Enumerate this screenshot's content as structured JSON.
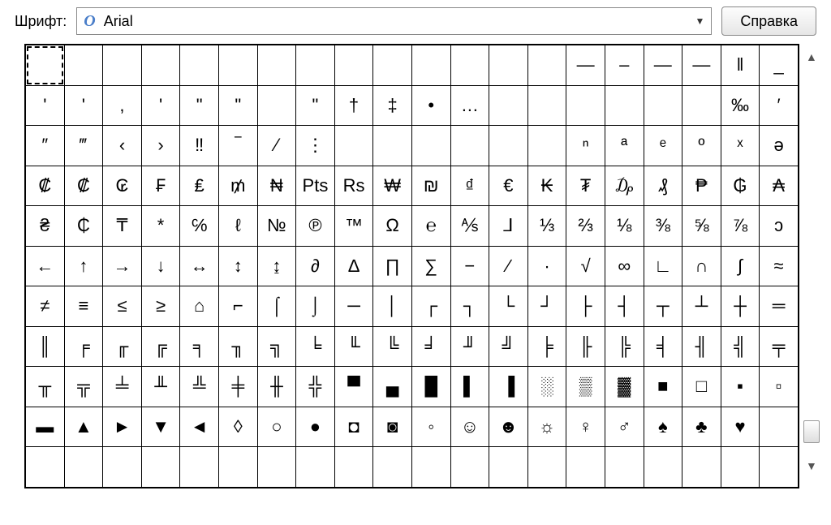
{
  "toolbar": {
    "font_label": "Шрифт:",
    "font_icon": "O",
    "font_name": "Arial",
    "help_label": "Справка"
  },
  "chart_data": {
    "type": "table",
    "title": "Character map grid",
    "columns": 20,
    "rows": 11,
    "selected_index": 0,
    "cells": [
      "",
      "",
      "",
      "",
      "",
      "",
      "",
      "",
      "",
      "",
      "",
      "",
      "",
      "",
      "—",
      "–",
      "—",
      "—",
      "‖",
      "_",
      "'",
      "'",
      ",",
      "'",
      "\"",
      "\"",
      "",
      "\"",
      "†",
      "‡",
      "•",
      "…",
      "",
      "",
      "",
      "",
      "",
      "",
      "‰",
      "′",
      "″",
      "‴",
      "‹",
      "›",
      "‼",
      "‾",
      "⁄",
      "⋮",
      "",
      "",
      "",
      "",
      "",
      "",
      "ⁿ",
      "ª",
      "ᵉ",
      "º",
      "ˣ",
      "ə",
      "₡",
      "₡",
      "₢",
      "₣",
      "₤",
      "₥",
      "₦",
      "Pts",
      "Rs",
      "₩",
      "₪",
      "₫",
      "€",
      "₭",
      "₮",
      "₯",
      "₰",
      "₱",
      "₲",
      "₳",
      "₴",
      "₵",
      "₸",
      "*",
      "℅",
      "ℓ",
      "№",
      "℗",
      "™",
      "Ω",
      "℮",
      "⅍",
      "⅃",
      "⅓",
      "⅔",
      "⅛",
      "⅜",
      "⅝",
      "⅞",
      "ↄ",
      "←",
      "↑",
      "→",
      "↓",
      "↔",
      "↕",
      "↨",
      "∂",
      "∆",
      "∏",
      "∑",
      "−",
      "∕",
      "∙",
      "√",
      "∞",
      "∟",
      "∩",
      "∫",
      "≈",
      "≠",
      "≡",
      "≤",
      "≥",
      "⌂",
      "⌐",
      "⌠",
      "⌡",
      "─",
      "│",
      "┌",
      "┐",
      "└",
      "┘",
      "├",
      "┤",
      "┬",
      "┴",
      "┼",
      "═",
      "║",
      "╒",
      "╓",
      "╔",
      "╕",
      "╖",
      "╗",
      "╘",
      "╙",
      "╚",
      "╛",
      "╜",
      "╝",
      "╞",
      "╟",
      "╠",
      "╡",
      "╢",
      "╣",
      "╤",
      "╥",
      "╦",
      "╧",
      "╨",
      "╩",
      "╪",
      "╫",
      "╬",
      "▀",
      "▄",
      "█",
      "▌",
      "▐",
      "░",
      "▒",
      "▓",
      "■",
      "□",
      "▪",
      "▫",
      "▬",
      "▲",
      "►",
      "▼",
      "◄",
      "◊",
      "○",
      "●",
      "◘",
      "◙",
      "◦",
      "☺",
      "☻",
      "☼",
      "♀",
      "♂",
      "♠",
      "♣",
      "♥"
    ]
  }
}
